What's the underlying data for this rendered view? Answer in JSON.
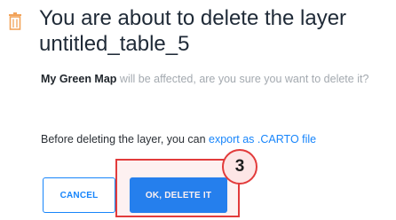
{
  "dialog": {
    "title": "You are about to delete the layer untitled_table_5",
    "warning_map_name": "My Green Map",
    "warning_text": " will be affected, are you sure you want to delete it?",
    "export_prefix": "Before deleting the layer, you can ",
    "export_link": "export as .CARTO file",
    "cancel_label": "CANCEL",
    "confirm_label": "OK, DELETE IT"
  },
  "annotation": {
    "step_number": "3"
  },
  "colors": {
    "accent": "#1785fb",
    "danger_icon": "#f2a35a",
    "annotation": "#e23b3b"
  },
  "icons": {
    "title_icon": "trash-icon"
  }
}
